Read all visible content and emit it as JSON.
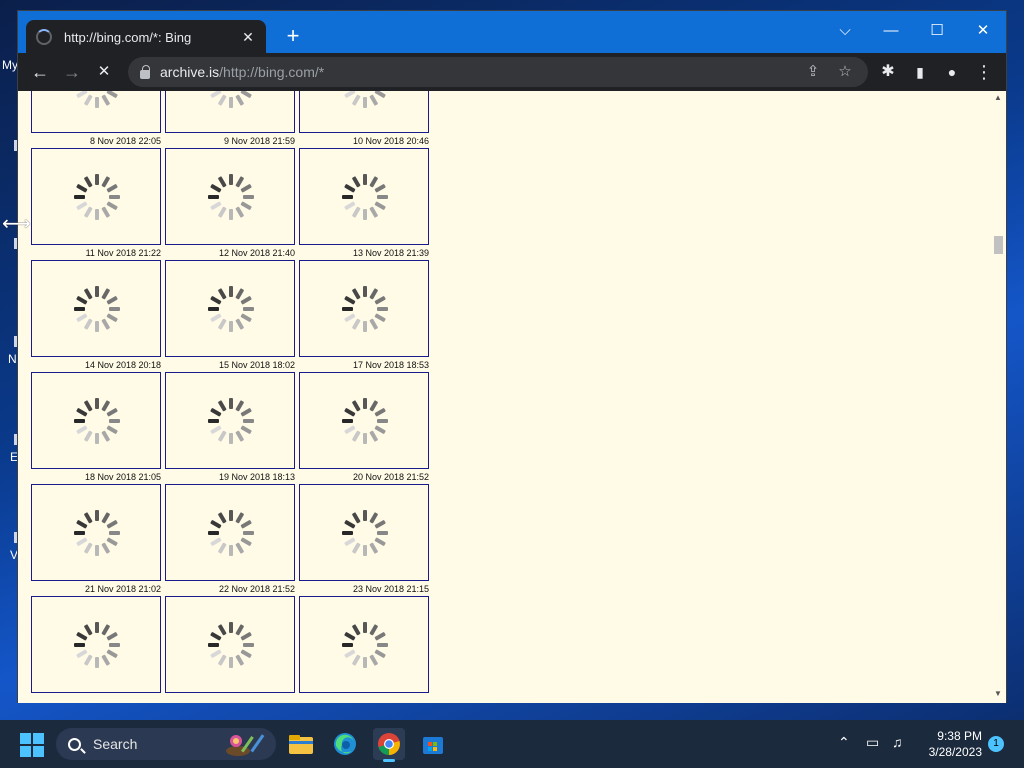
{
  "desktop": {
    "fragments": [
      "My",
      "N",
      "E",
      "V"
    ]
  },
  "browser": {
    "tab_title": "http://bing.com/*: Bing",
    "tab_close": "✕",
    "new_tab": "+",
    "controls": {
      "tab_search": "⌵",
      "minimize": "—",
      "maximize": "☐",
      "close": "✕"
    },
    "nav": {
      "back": "←",
      "forward": "→",
      "stop": "✕"
    },
    "url_domain": "archive.is",
    "url_rest": "/http://bing.com/*",
    "omnibox_icons": {
      "share": "⇪",
      "bookmark": "☆"
    },
    "toolbar_icons": {
      "extensions": "✱",
      "side_panel": "▮",
      "profile": "●",
      "menu": "⋮"
    }
  },
  "page": {
    "rows": [
      [
        "8 Nov 2018 22:05",
        "9 Nov 2018 21:59",
        "10 Nov 2018 20:46"
      ],
      [
        "11 Nov 2018 21:22",
        "12 Nov 2018 21:40",
        "13 Nov 2018 21:39"
      ],
      [
        "14 Nov 2018 20:18",
        "15 Nov 2018 18:02",
        "17 Nov 2018 18:53"
      ],
      [
        "18 Nov 2018 21:05",
        "19 Nov 2018 18:13",
        "20 Nov 2018 21:52"
      ],
      [
        "21 Nov 2018 21:02",
        "22 Nov 2018 21:52",
        "23 Nov 2018 21:15"
      ],
      [
        "",
        "",
        ""
      ]
    ]
  },
  "taskbar": {
    "search_label": "Search",
    "time": "9:38 PM",
    "date": "3/28/2023",
    "notification_count": "1",
    "apps": [
      "file-explorer",
      "edge",
      "chrome",
      "store"
    ]
  },
  "colors": {
    "page_bg": "#fffbe6",
    "thumb_border": "#1a1a8c",
    "titlebar": "#0f6fd6",
    "accent": "#4cc2ff"
  }
}
